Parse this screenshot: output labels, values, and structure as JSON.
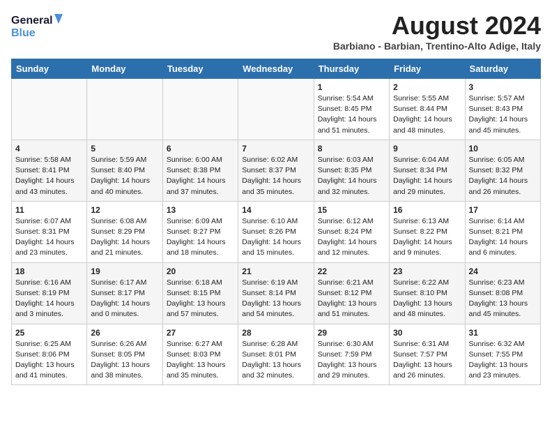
{
  "header": {
    "logo_line1": "General",
    "logo_line2": "Blue",
    "month_year": "August 2024",
    "location": "Barbiano - Barbian, Trentino-Alto Adige, Italy"
  },
  "columns": [
    "Sunday",
    "Monday",
    "Tuesday",
    "Wednesday",
    "Thursday",
    "Friday",
    "Saturday"
  ],
  "weeks": [
    [
      {
        "day": "",
        "detail": ""
      },
      {
        "day": "",
        "detail": ""
      },
      {
        "day": "",
        "detail": ""
      },
      {
        "day": "",
        "detail": ""
      },
      {
        "day": "1",
        "detail": "Sunrise: 5:54 AM\nSunset: 8:45 PM\nDaylight: 14 hours\nand 51 minutes."
      },
      {
        "day": "2",
        "detail": "Sunrise: 5:55 AM\nSunset: 8:44 PM\nDaylight: 14 hours\nand 48 minutes."
      },
      {
        "day": "3",
        "detail": "Sunrise: 5:57 AM\nSunset: 8:43 PM\nDaylight: 14 hours\nand 45 minutes."
      }
    ],
    [
      {
        "day": "4",
        "detail": "Sunrise: 5:58 AM\nSunset: 8:41 PM\nDaylight: 14 hours\nand 43 minutes."
      },
      {
        "day": "5",
        "detail": "Sunrise: 5:59 AM\nSunset: 8:40 PM\nDaylight: 14 hours\nand 40 minutes."
      },
      {
        "day": "6",
        "detail": "Sunrise: 6:00 AM\nSunset: 8:38 PM\nDaylight: 14 hours\nand 37 minutes."
      },
      {
        "day": "7",
        "detail": "Sunrise: 6:02 AM\nSunset: 8:37 PM\nDaylight: 14 hours\nand 35 minutes."
      },
      {
        "day": "8",
        "detail": "Sunrise: 6:03 AM\nSunset: 8:35 PM\nDaylight: 14 hours\nand 32 minutes."
      },
      {
        "day": "9",
        "detail": "Sunrise: 6:04 AM\nSunset: 8:34 PM\nDaylight: 14 hours\nand 29 minutes."
      },
      {
        "day": "10",
        "detail": "Sunrise: 6:05 AM\nSunset: 8:32 PM\nDaylight: 14 hours\nand 26 minutes."
      }
    ],
    [
      {
        "day": "11",
        "detail": "Sunrise: 6:07 AM\nSunset: 8:31 PM\nDaylight: 14 hours\nand 23 minutes."
      },
      {
        "day": "12",
        "detail": "Sunrise: 6:08 AM\nSunset: 8:29 PM\nDaylight: 14 hours\nand 21 minutes."
      },
      {
        "day": "13",
        "detail": "Sunrise: 6:09 AM\nSunset: 8:27 PM\nDaylight: 14 hours\nand 18 minutes."
      },
      {
        "day": "14",
        "detail": "Sunrise: 6:10 AM\nSunset: 8:26 PM\nDaylight: 14 hours\nand 15 minutes."
      },
      {
        "day": "15",
        "detail": "Sunrise: 6:12 AM\nSunset: 8:24 PM\nDaylight: 14 hours\nand 12 minutes."
      },
      {
        "day": "16",
        "detail": "Sunrise: 6:13 AM\nSunset: 8:22 PM\nDaylight: 14 hours\nand 9 minutes."
      },
      {
        "day": "17",
        "detail": "Sunrise: 6:14 AM\nSunset: 8:21 PM\nDaylight: 14 hours\nand 6 minutes."
      }
    ],
    [
      {
        "day": "18",
        "detail": "Sunrise: 6:16 AM\nSunset: 8:19 PM\nDaylight: 14 hours\nand 3 minutes."
      },
      {
        "day": "19",
        "detail": "Sunrise: 6:17 AM\nSunset: 8:17 PM\nDaylight: 14 hours\nand 0 minutes."
      },
      {
        "day": "20",
        "detail": "Sunrise: 6:18 AM\nSunset: 8:15 PM\nDaylight: 13 hours\nand 57 minutes."
      },
      {
        "day": "21",
        "detail": "Sunrise: 6:19 AM\nSunset: 8:14 PM\nDaylight: 13 hours\nand 54 minutes."
      },
      {
        "day": "22",
        "detail": "Sunrise: 6:21 AM\nSunset: 8:12 PM\nDaylight: 13 hours\nand 51 minutes."
      },
      {
        "day": "23",
        "detail": "Sunrise: 6:22 AM\nSunset: 8:10 PM\nDaylight: 13 hours\nand 48 minutes."
      },
      {
        "day": "24",
        "detail": "Sunrise: 6:23 AM\nSunset: 8:08 PM\nDaylight: 13 hours\nand 45 minutes."
      }
    ],
    [
      {
        "day": "25",
        "detail": "Sunrise: 6:25 AM\nSunset: 8:06 PM\nDaylight: 13 hours\nand 41 minutes."
      },
      {
        "day": "26",
        "detail": "Sunrise: 6:26 AM\nSunset: 8:05 PM\nDaylight: 13 hours\nand 38 minutes."
      },
      {
        "day": "27",
        "detail": "Sunrise: 6:27 AM\nSunset: 8:03 PM\nDaylight: 13 hours\nand 35 minutes."
      },
      {
        "day": "28",
        "detail": "Sunrise: 6:28 AM\nSunset: 8:01 PM\nDaylight: 13 hours\nand 32 minutes."
      },
      {
        "day": "29",
        "detail": "Sunrise: 6:30 AM\nSunset: 7:59 PM\nDaylight: 13 hours\nand 29 minutes."
      },
      {
        "day": "30",
        "detail": "Sunrise: 6:31 AM\nSunset: 7:57 PM\nDaylight: 13 hours\nand 26 minutes."
      },
      {
        "day": "31",
        "detail": "Sunrise: 6:32 AM\nSunset: 7:55 PM\nDaylight: 13 hours\nand 23 minutes."
      }
    ]
  ]
}
